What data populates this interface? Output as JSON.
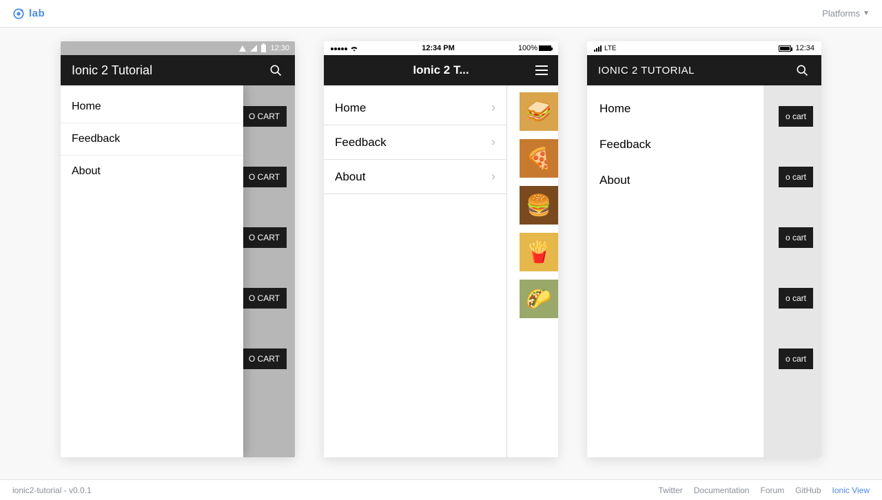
{
  "topbar": {
    "brand": "lab",
    "platforms_label": "Platforms"
  },
  "status": {
    "android": {
      "time": "12:30"
    },
    "ios": {
      "time": "12:34 PM",
      "battery_pct": "100%"
    },
    "wp": {
      "net": "LTE",
      "time": "12:34"
    }
  },
  "app": {
    "title_android": "Ionic 2 Tutorial",
    "title_ios": "Ionic 2 T...",
    "title_wp": "IONIC 2 TUTORIAL"
  },
  "menu": {
    "items": [
      {
        "label": "Home"
      },
      {
        "label": "Feedback"
      },
      {
        "label": "About"
      }
    ]
  },
  "buttons": {
    "add_cart_android": "O CART",
    "add_cart_wp": "o cart"
  },
  "foods": [
    "sandwich-thumb",
    "pizza-thumb",
    "burger-thumb",
    "fries-thumb",
    "tacos-thumb"
  ],
  "footer": {
    "project": "ionic2-tutorial - v0.0.1",
    "links": [
      {
        "label": "Twitter"
      },
      {
        "label": "Documentation"
      },
      {
        "label": "Forum"
      },
      {
        "label": "GitHub"
      },
      {
        "label": "Ionic View",
        "accent": true
      }
    ]
  }
}
